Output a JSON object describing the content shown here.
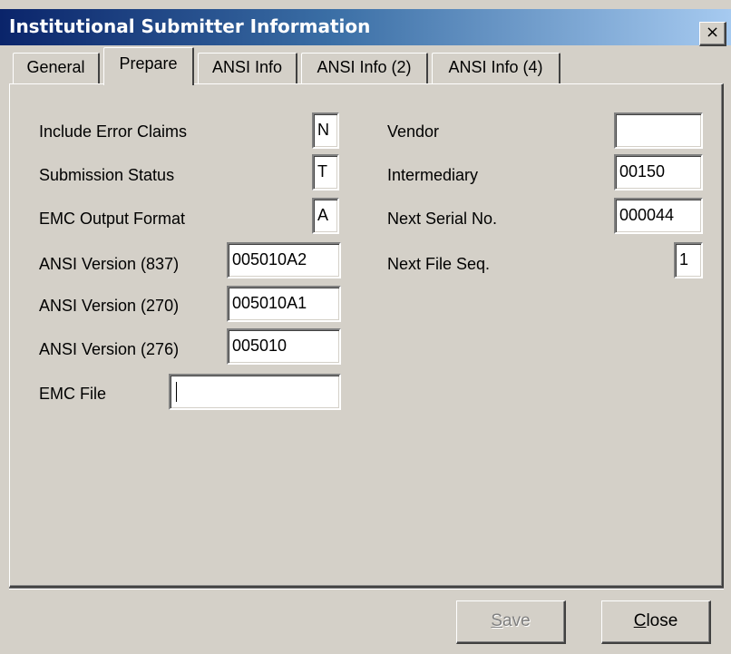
{
  "window": {
    "title": "Institutional Submitter Information",
    "close_glyph": "×"
  },
  "tabs": [
    {
      "label": "General"
    },
    {
      "label": "Prepare"
    },
    {
      "label": "ANSI Info"
    },
    {
      "label": "ANSI Info (2)"
    },
    {
      "label": "ANSI Info (4)"
    }
  ],
  "active_tab": "Prepare",
  "form": {
    "include_error_claims": {
      "label": "Include Error Claims",
      "value": "N"
    },
    "submission_status": {
      "label": "Submission Status",
      "value": "T"
    },
    "emc_output_format": {
      "label": "EMC Output Format",
      "value": "A"
    },
    "ansi_version_837": {
      "label": "ANSI Version (837)",
      "value": "005010A2"
    },
    "ansi_version_270": {
      "label": "ANSI Version (270)",
      "value": "005010A1"
    },
    "ansi_version_276": {
      "label": "ANSI Version (276)",
      "value": "005010"
    },
    "emc_file": {
      "label": "EMC File",
      "value": ""
    },
    "vendor": {
      "label": "Vendor",
      "value": ""
    },
    "intermediary": {
      "label": "Intermediary",
      "value": "00150"
    },
    "next_serial_no": {
      "label": "Next Serial No.",
      "value": "000044"
    },
    "next_file_seq": {
      "label": "Next File Seq.",
      "value": "1"
    }
  },
  "buttons": {
    "save": {
      "mnemonic": "S",
      "rest": "ave",
      "enabled": false
    },
    "close": {
      "mnemonic": "C",
      "rest": "lose",
      "enabled": true
    }
  }
}
